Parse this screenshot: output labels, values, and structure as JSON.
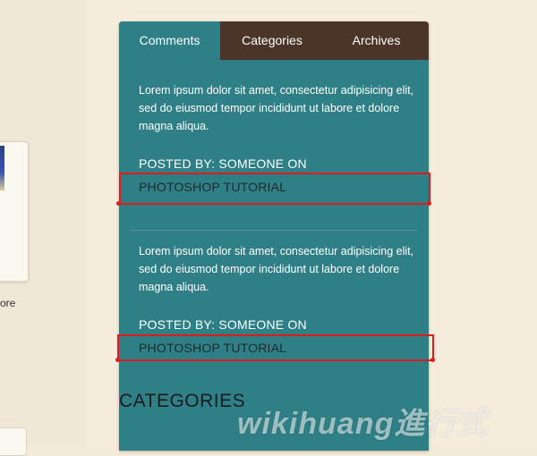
{
  "tabs": [
    {
      "label": "Comments",
      "active": true
    },
    {
      "label": "Categories",
      "active": false
    },
    {
      "label": "Archives",
      "active": false
    }
  ],
  "entries": [
    {
      "text": "Lorem ipsum dolor sit amet, consectetur adipisicing elit, sed do eiusmod tempor incididunt ut labore et dolore magna aliqua.",
      "posted_by": "POSTED BY: SOMEONE ON",
      "link": "PHOTOSHOP TUTORIAL"
    },
    {
      "text": "Lorem ipsum dolor sit amet, consectetur adipisicing elit, sed do eiusmod tempor incididunt ut labore et dolore magna aliqua.",
      "posted_by": "POSTED BY: SOMEONE ON",
      "link": "PHOTOSHOP TUTORIAL"
    }
  ],
  "categories_heading": "CATEGORIES",
  "thumb_caption": "ore",
  "watermark": "wikihuang進行式",
  "colors": {
    "widget_bg": "#2f7f86",
    "tab_bar_bg": "#4a3528",
    "page_bg": "#f5ecdb",
    "highlight": "#e01b1b"
  }
}
